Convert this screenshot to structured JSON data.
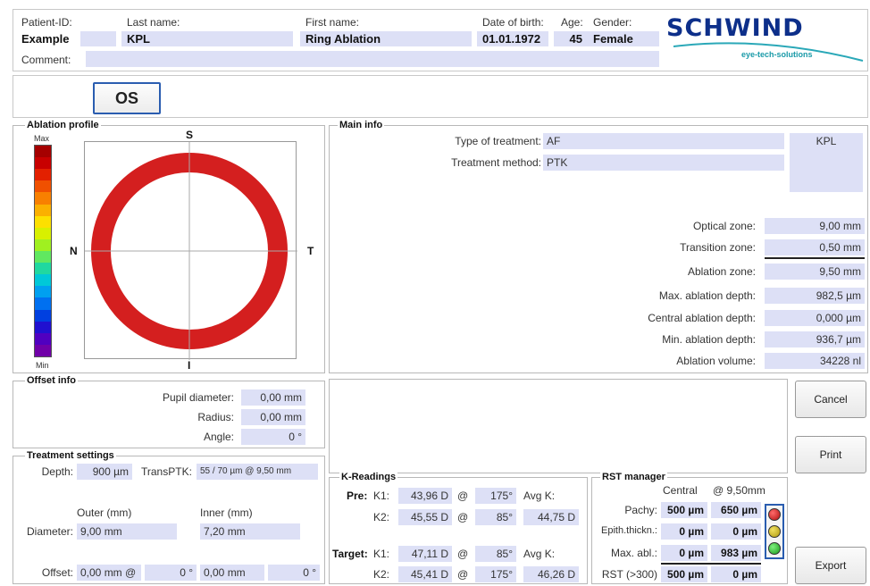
{
  "header": {
    "patient_id_label": "Patient-ID:",
    "patient_id": "Example",
    "last_name_label": "Last name:",
    "last_name": "KPL",
    "first_name_label": "First name:",
    "first_name": "Ring Ablation",
    "dob_label": "Date of birth:",
    "dob": "01.01.1972",
    "age_label": "Age:",
    "age": "45",
    "gender_label": "Gender:",
    "gender": "Female",
    "comment_label": "Comment:",
    "comment": "",
    "logo_text": "SCHWIND",
    "logo_sub": "eye-tech-solutions"
  },
  "eye_button": "OS",
  "ablation_profile": {
    "title": "Ablation profile",
    "max_label": "Max",
    "min_label": "Min",
    "north": "S",
    "south": "I",
    "west": "N",
    "east": "T",
    "colors": {
      "ring": "#d41f1f",
      "scale": [
        "#a50000",
        "#c80000",
        "#e32000",
        "#f05000",
        "#f88000",
        "#fbb000",
        "#fde000",
        "#d8f000",
        "#a0f020",
        "#60e860",
        "#20d8a0",
        "#00c8d8",
        "#00a0f0",
        "#0070f0",
        "#0040e0",
        "#2010d0",
        "#5000c0",
        "#7000a8"
      ]
    }
  },
  "main_info": {
    "title": "Main info",
    "type_label": "Type of treatment:",
    "type_value": "AF",
    "method_label": "Treatment method:",
    "method_value": "PTK",
    "side_value": "KPL",
    "rows": [
      {
        "label": "Optical zone:",
        "value": "9,00 mm"
      },
      {
        "label": "Transition zone:",
        "value": "0,50 mm"
      },
      {
        "label": "Ablation zone:",
        "value": "9,50 mm"
      },
      {
        "label": "Max. ablation depth:",
        "value": "982,5 µm"
      },
      {
        "label": "Central ablation depth:",
        "value": "0,000 µm"
      },
      {
        "label": "Min. ablation depth:",
        "value": "936,7 µm"
      },
      {
        "label": "Ablation volume:",
        "value": "34228 nl"
      }
    ]
  },
  "offset_info": {
    "title": "Offset info",
    "pupil_label": "Pupil diameter:",
    "pupil_value": "0,00 mm",
    "radius_label": "Radius:",
    "radius_value": "0,00 mm",
    "angle_label": "Angle:",
    "angle_value": "0 °"
  },
  "treatment_settings": {
    "title": "Treatment settings",
    "depth_label": "Depth:",
    "depth_value": "900 µm",
    "transptk_label": "TransPTK:",
    "transptk_value": "55 / 70 µm @ 9,50 mm",
    "outer_label": "Outer (mm)",
    "inner_label": "Inner (mm)",
    "diameter_label": "Diameter:",
    "outer_value": "9,00 mm",
    "inner_value": "7,20 mm",
    "offset_label": "Offset:",
    "offset_outer": "0,00 mm @",
    "offset_outer_angle": "0 °",
    "offset_inner": "0,00 mm",
    "offset_inner_angle": "0 °"
  },
  "k_readings": {
    "title": "K-Readings",
    "pre_label": "Pre:",
    "target_label": "Target:",
    "k1_label": "K1:",
    "k2_label": "K2:",
    "at": "@",
    "avgk_label": "Avg K:",
    "pre_k1": "43,96 D",
    "pre_k1_axis": "175°",
    "pre_k2": "45,55 D",
    "pre_k2_axis": "85°",
    "pre_avgk": "44,75 D",
    "target_k1": "47,11 D",
    "target_k1_axis": "85°",
    "target_k2": "45,41 D",
    "target_k2_axis": "175°",
    "target_avgk": "46,26 D"
  },
  "rst_manager": {
    "title": "RST manager",
    "central_label": "Central",
    "edge_label": "@ 9,50mm",
    "rows": [
      {
        "label": "Pachy:",
        "central": "500 µm",
        "edge": "650 µm"
      },
      {
        "label": "Epith.thickn.:",
        "central": "0 µm",
        "edge": "0 µm"
      },
      {
        "label": "Max. abl.:",
        "central": "0 µm",
        "edge": "983 µm"
      },
      {
        "label": "RST (>300)",
        "central": "500 µm",
        "edge": "0 µm"
      }
    ],
    "lights": {
      "red": "#b01010",
      "yellow": "#b09a10",
      "green": "#1a9a1a"
    }
  },
  "buttons": {
    "cancel": "Cancel",
    "print": "Print",
    "export": "Export"
  }
}
